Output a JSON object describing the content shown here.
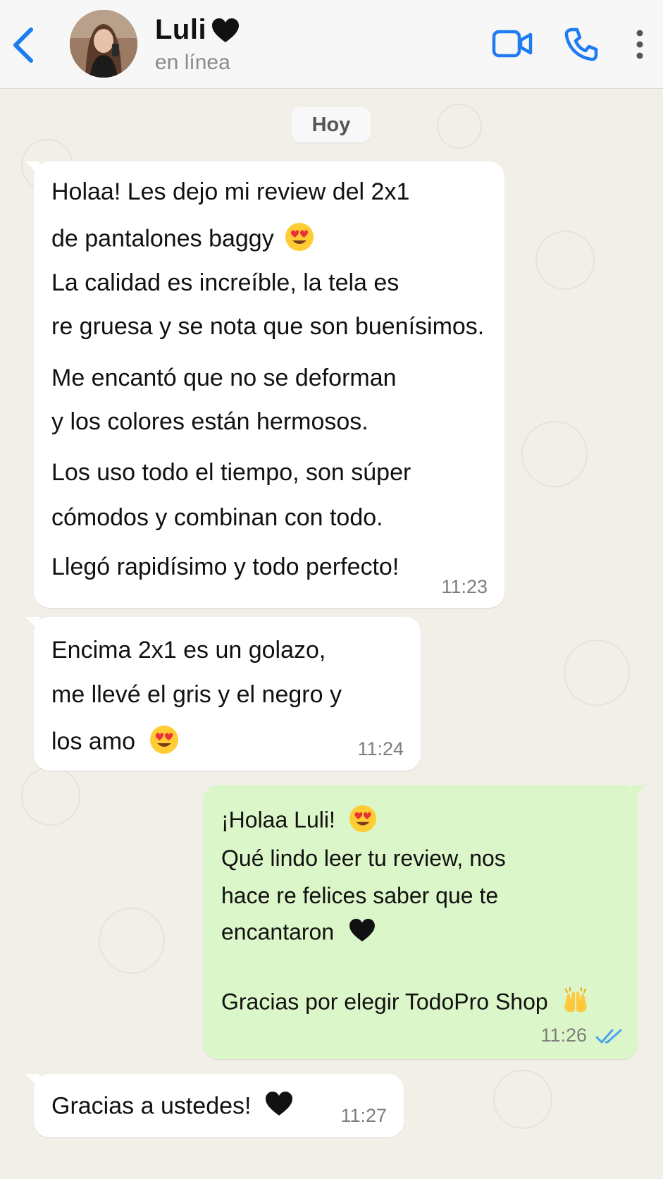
{
  "header": {
    "contact_name": "Luli",
    "status": "en línea"
  },
  "date_chip": "Hoy",
  "messages": [
    {
      "lines": [
        "Holaa! Les dejo mi review del 2x1",
        "de pantalones baggy",
        "La calidad es increíble, la tela es",
        "re gruesa y se nota que son buenísimos.",
        "Me encantó que no se deforman",
        "y los colores están hermosos.",
        "Los uso todo el tiempo, son súper",
        "cómodos y combinan con todo.",
        "Llegó rapidísimo y todo perfecto!"
      ],
      "time": "11:23"
    },
    {
      "lines": [
        "Encima 2x1 es un golazo,",
        "me llevé el gris y el negro y",
        "los amo"
      ],
      "time": "11:24"
    },
    {
      "lines": [
        "¡Holaa Luli!",
        "Qué lindo leer tu review, nos",
        "hace re felices saber que te",
        "encantaron",
        "Gracias por elegir TodoPro Shop"
      ],
      "time": "11:26"
    },
    {
      "lines": [
        "Gracias a ustedes!"
      ],
      "time": "11:27"
    }
  ],
  "colors": {
    "accent_blue": "#1e7cf2",
    "incoming_bubble": "#ffffff",
    "outgoing_bubble": "#dbf6c8",
    "read_ticks": "#4aa3f0"
  },
  "icons": [
    "back-chevron-icon",
    "video-call-icon",
    "phone-icon",
    "more-vertical-icon",
    "heart-eyes-emoji",
    "black-heart-emoji",
    "raised-hands-emoji",
    "double-check-icon"
  ]
}
